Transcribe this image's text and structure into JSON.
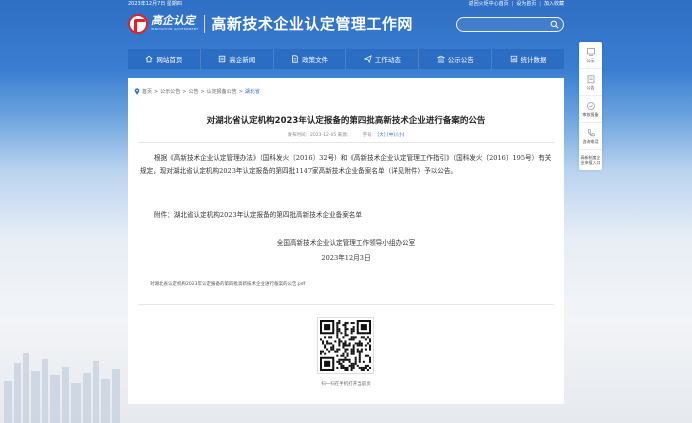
{
  "topbar": {
    "date": "2023年12月7日 星期四",
    "links": [
      "返回火炬中心首页",
      "设为首页",
      "加入收藏"
    ]
  },
  "header": {
    "logo_cn": "高企认定",
    "logo_en": "INNOVATION GOVERNMENT",
    "site_title": "高新技术企业认定管理工作网"
  },
  "nav": {
    "items": [
      {
        "label": "网站首页",
        "icon": "home-icon"
      },
      {
        "label": "高企新闻",
        "icon": "news-icon"
      },
      {
        "label": "政策文件",
        "icon": "document-icon"
      },
      {
        "label": "工作动态",
        "icon": "send-icon"
      },
      {
        "label": "公示公告",
        "icon": "bank-icon"
      },
      {
        "label": "统计数据",
        "icon": "chart-icon"
      }
    ]
  },
  "breadcrumb": {
    "items": [
      "首页",
      "公示公告",
      "公告",
      "认定报备公告"
    ],
    "current": "湖北省"
  },
  "article": {
    "title": "对湖北省认定机构2023年认定报备的第四批高新技术企业进行备案的公告",
    "publish_label": "发布时间：2023-12-05 来源：",
    "font_label": "字号：",
    "font_large": "[大]",
    "font_medium": "[中]",
    "font_small": "[小]",
    "paragraph": "根据《高新技术企业认定管理办法》（国科发火〔2016〕32号）和《高新技术企业认定管理工作指引》（国科发火〔2016〕195号）有关规定，现对湖北省认定机构2023年认定报备的第四批1147家高新技术企业备案名单（详见附件）予以公告。",
    "attachment_label": "附件：湖北省认定机构2023年认定报备的第四批高新技术企业备案名单",
    "sign_org": "全国高新技术企业认定管理工作领导小组办公室",
    "sign_date": "2023年12月3日",
    "pdf_link": "对湖北省认定机构2023年认定报备的第四批高新技术企业进行备案的公告.pdf",
    "qr_caption": "扫一扫在手机打开当前页"
  },
  "side": {
    "items": [
      {
        "label": "公示",
        "icon": "display-icon"
      },
      {
        "label": "公告",
        "icon": "clipboard-icon"
      },
      {
        "label": "审核报备",
        "icon": "review-icon"
      },
      {
        "label": "咨询电话",
        "icon": "phone-icon"
      },
      {
        "label": "高新制度企业申报入口",
        "icon": "entry-icon"
      }
    ]
  },
  "search": {
    "placeholder": ""
  },
  "colors": {
    "brand_blue": "#2a6dc2",
    "logo_red": "#d8262c"
  }
}
